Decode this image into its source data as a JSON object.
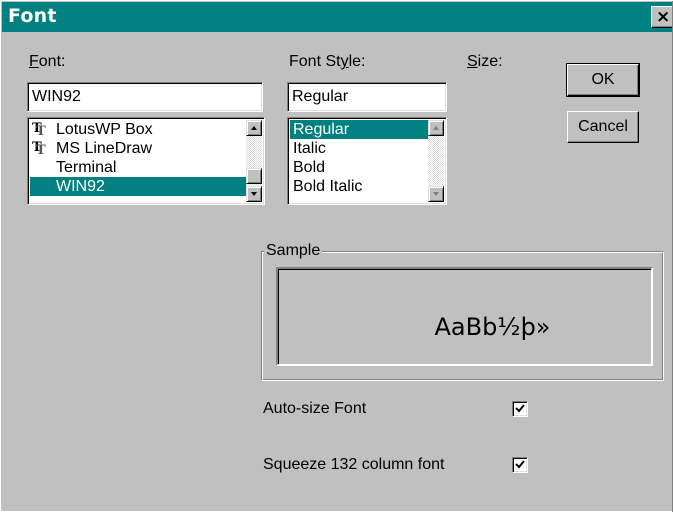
{
  "window": {
    "title": "Font",
    "close_label": "×",
    "title_bar_color": "#008080",
    "selection_color": "#008080"
  },
  "font": {
    "label": "Font:",
    "mnemonic": "F",
    "label_rest": "ont:",
    "value": "WIN92",
    "items": [
      {
        "label": "LotusWP Box",
        "icon": "truetype-icon",
        "selected": false
      },
      {
        "label": "MS LineDraw",
        "icon": "truetype-icon",
        "selected": false
      },
      {
        "label": "Terminal",
        "icon": "",
        "selected": false
      },
      {
        "label": "WIN92",
        "icon": "",
        "selected": true
      }
    ]
  },
  "font_style": {
    "label": "Font Style:",
    "label_pre": "Font St",
    "mnemonic": "y",
    "label_post": "le:",
    "value": "Regular",
    "items": [
      {
        "label": "Regular",
        "selected": true
      },
      {
        "label": "Italic",
        "selected": false
      },
      {
        "label": "Bold",
        "selected": false
      },
      {
        "label": "Bold Italic",
        "selected": false
      }
    ]
  },
  "size": {
    "label": "Size:",
    "mnemonic": "S",
    "label_rest": "ize:"
  },
  "buttons": {
    "ok_label": "OK",
    "cancel_label": "Cancel"
  },
  "sample": {
    "legend": "Sample",
    "text": "AaBb½þ»"
  },
  "options": {
    "autosize_label": "Auto-size Font",
    "autosize_checked": true,
    "squeeze_label": "Squeeze 132 column font",
    "squeeze_checked": true
  }
}
